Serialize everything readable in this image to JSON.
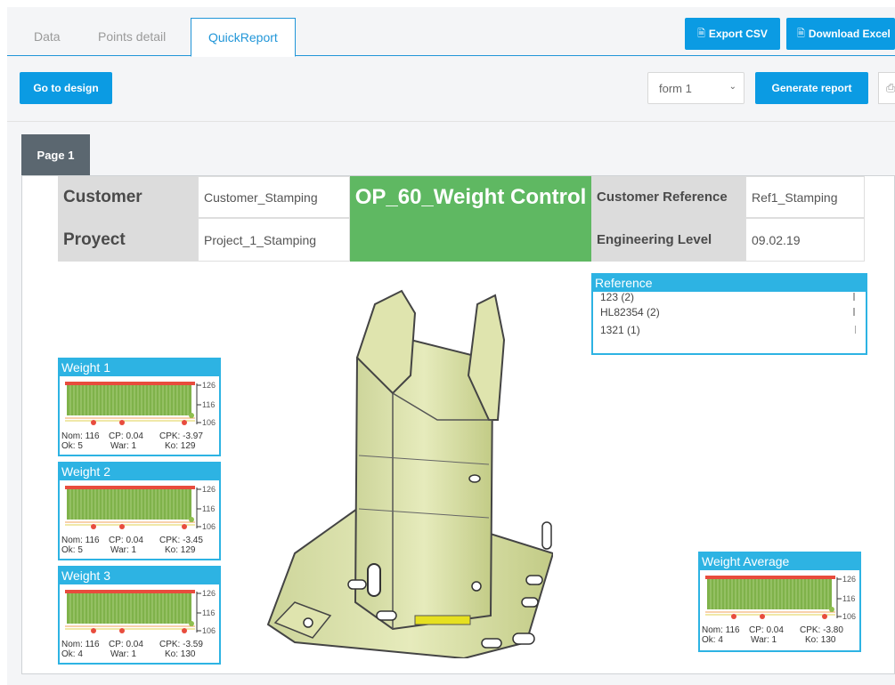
{
  "tabs": [
    {
      "label": "Data",
      "active": false
    },
    {
      "label": "Points detail",
      "active": false
    },
    {
      "label": "QuickReport",
      "active": true
    }
  ],
  "toolbar": {
    "export_csv": "Export CSV",
    "download_excel": "Download Excel",
    "go_to_design": "Go to design",
    "form_select_value": "form 1",
    "generate_report": "Generate report"
  },
  "page_tab": "Page 1",
  "header": {
    "customer_label": "Customer",
    "customer_value": "Customer_Stamping",
    "project_label": "Proyect",
    "project_value": "Project_1_Stamping",
    "title": "OP_60_Weight Control",
    "customer_ref_label": "Customer Reference",
    "customer_ref_value": "Ref1_Stamping",
    "eng_level_label": "Engineering Level",
    "eng_level_value": "09.02.19"
  },
  "reference": {
    "title": "Reference",
    "items": [
      {
        "label": "123 (2)",
        "level": 1.0
      },
      {
        "label": "HL82354 (2)",
        "level": 1.0
      },
      {
        "label": "1321 (1)",
        "level": 0.5
      }
    ]
  },
  "widgets": [
    {
      "title": "Weight 1",
      "axis": [
        "126",
        "116",
        "106"
      ],
      "nom": "Nom: 116",
      "cp": "CP: 0.04",
      "cpk": "CPK: -3.97",
      "ok": "Ok: 5",
      "war": "War: 1",
      "ko": "Ko: 129"
    },
    {
      "title": "Weight 2",
      "axis": [
        "126",
        "116",
        "106"
      ],
      "nom": "Nom: 116",
      "cp": "CP: 0.04",
      "cpk": "CPK: -3.45",
      "ok": "Ok: 5",
      "war": "War: 1",
      "ko": "Ko: 129"
    },
    {
      "title": "Weight 3",
      "axis": [
        "126",
        "116",
        "106"
      ],
      "nom": "Nom: 116",
      "cp": "CP: 0.04",
      "cpk": "CPK: -3.59",
      "ok": "Ok: 4",
      "war": "War: 1",
      "ko": "Ko: 130"
    },
    {
      "title": "Weight Average",
      "axis": [
        "126",
        "116",
        "106"
      ],
      "nom": "Nom: 116",
      "cp": "CP: 0.04",
      "cpk": "CPK: -3.80",
      "ok": "Ok: 4",
      "war": "War: 1",
      "ko": "Ko: 130"
    }
  ],
  "colors": {
    "accent": "#0b9be3",
    "widget_border": "#2db3e3",
    "title_green": "#5fb862",
    "bar_green": "#7fb24a",
    "limit_red": "#e84c3d",
    "tolerance_orange": "#f0a35a",
    "page_tab": "#5b6770"
  }
}
